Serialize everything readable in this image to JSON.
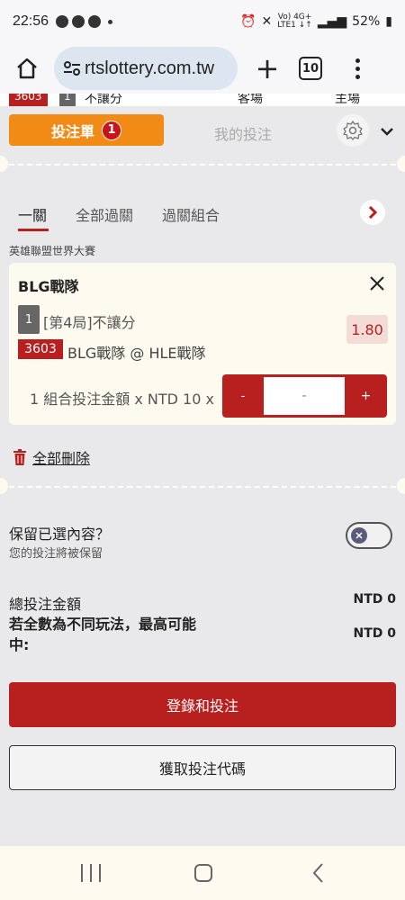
{
  "status_bar": {
    "time": "22:56",
    "battery": "52%",
    "network_top": "Vo) 4G+",
    "network_bottom": "LTE1 ↓↑"
  },
  "browser": {
    "url": "rtslottery.com.tw",
    "tab_count": "10"
  },
  "peek_row": {
    "match_id": "3603",
    "num": "1",
    "text": "不讓分",
    "col2": "客場",
    "col3": "主場"
  },
  "bet_slip": {
    "slip_tab_label": "投注單",
    "slip_count": "1",
    "my_bets_label": "我的投注",
    "sub_tabs": [
      "一關",
      "全部過關",
      "過關組合"
    ],
    "league": "英雄聯盟世界大賽",
    "bet": {
      "team": "BLG戰隊",
      "selection_num": "1",
      "market": "[第4局]不讓分",
      "odds": "1.80",
      "match_id": "3603",
      "match_name": "BLG戰隊 @ HLE戰隊",
      "stake_label": "1 組合投注金額 x NTD 10 x",
      "stake_minus": "-",
      "stake_value": "-",
      "stake_plus": "+"
    },
    "delete_all_label": "全部刪除",
    "keep_title": "保留已選內容？",
    "keep_sub": "您的投注將被保留",
    "total_label": "總投注金額",
    "total_value": "NTD 0",
    "max_label": "若全數為不同玩法，最高可能中:",
    "max_value": "NTD 0",
    "login_button": "登錄和投注",
    "code_button": "獲取投注代碼"
  },
  "colors": {
    "accent_red": "#b81f1f",
    "orange": "#f28a16",
    "card_bg": "#fdfbf0",
    "panel_bg": "#e9e9eb"
  }
}
